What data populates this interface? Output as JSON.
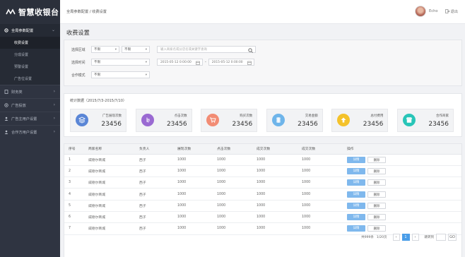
{
  "app": {
    "logo_text": "智慧收银台"
  },
  "sidebar": {
    "groups": [
      {
        "label": "全局参数配置",
        "icon": "gear-icon"
      },
      {
        "label": "财务类",
        "icon": "document-icon"
      },
      {
        "label": "广告投放",
        "icon": "target-icon"
      },
      {
        "label": "广告主用户设置",
        "icon": "user-icon"
      },
      {
        "label": "合作方用户设置",
        "icon": "user-icon"
      }
    ],
    "sub_items": [
      "收费设置",
      "分成设置",
      "预警设置",
      "广告位设置"
    ]
  },
  "topbar": {
    "breadcrumb": "全局参数配置 / 收费设置",
    "username": "Echo",
    "logout": "退出"
  },
  "page": {
    "title": "收费设置"
  },
  "filter": {
    "region_label": "选择区域",
    "region_value1": "不限",
    "region_value2": "不限",
    "search_placeholder": "输入商家名或分店名或关键字查询",
    "time_label": "选择时间",
    "time_value": "不限",
    "date_start": "2015-05-12 0:00:00",
    "date_sep": "-",
    "date_end": "2015-05-12 0:00:00",
    "mode_label": "合作模式",
    "mode_value": "不限"
  },
  "stats": {
    "title": "统计数据（2015/7/3-2015/7/10）",
    "items": [
      {
        "name": "广告展现次数",
        "value": "23456",
        "color": "#5a86d6",
        "icon": "layers-icon"
      },
      {
        "name": "点击次数",
        "value": "23456",
        "color": "#9a6ad2",
        "icon": "pointer-icon"
      },
      {
        "name": "购买次数",
        "value": "23456",
        "color": "#f28c74",
        "icon": "cart-icon"
      },
      {
        "name": "交易金额",
        "value": "23456",
        "color": "#6fb5ea",
        "icon": "coins-icon"
      },
      {
        "name": "总付费用",
        "value": "23456",
        "color": "#f4c22b",
        "icon": "upload-icon"
      },
      {
        "name": "合作商家",
        "value": "23456",
        "color": "#28c5b8",
        "icon": "shop-icon"
      }
    ]
  },
  "table": {
    "headers": [
      "序号",
      "商家名称",
      "负责人",
      "展现次数",
      "点击次数",
      "成交次数",
      "成交次数",
      "操作"
    ],
    "rows": [
      [
        "1",
        "威德尔商城",
        "西子",
        "1000",
        "1000",
        "1000",
        "1000"
      ],
      [
        "2",
        "威德尔商城",
        "西子",
        "1000",
        "1000",
        "1000",
        "1000"
      ],
      [
        "3",
        "威德尔商城",
        "西子",
        "1000",
        "1000",
        "1000",
        "1000"
      ],
      [
        "4",
        "威德尔商城",
        "西子",
        "1000",
        "1000",
        "1000",
        "1000"
      ],
      [
        "5",
        "威德尔商城",
        "西子",
        "1000",
        "1000",
        "1000",
        "1000"
      ],
      [
        "6",
        "威德尔商城",
        "西子",
        "1000",
        "1000",
        "1000",
        "1000"
      ],
      [
        "7",
        "威德尔商城",
        "西子",
        "1000",
        "1000",
        "1000",
        "1000"
      ]
    ],
    "detail_label": "详情",
    "delete_label": "删除"
  },
  "pager": {
    "total": "共999条",
    "page_info": "1/20页",
    "prev": "‹",
    "current": "1",
    "next": "›",
    "jump_label": "跳转到",
    "go": "GO"
  }
}
